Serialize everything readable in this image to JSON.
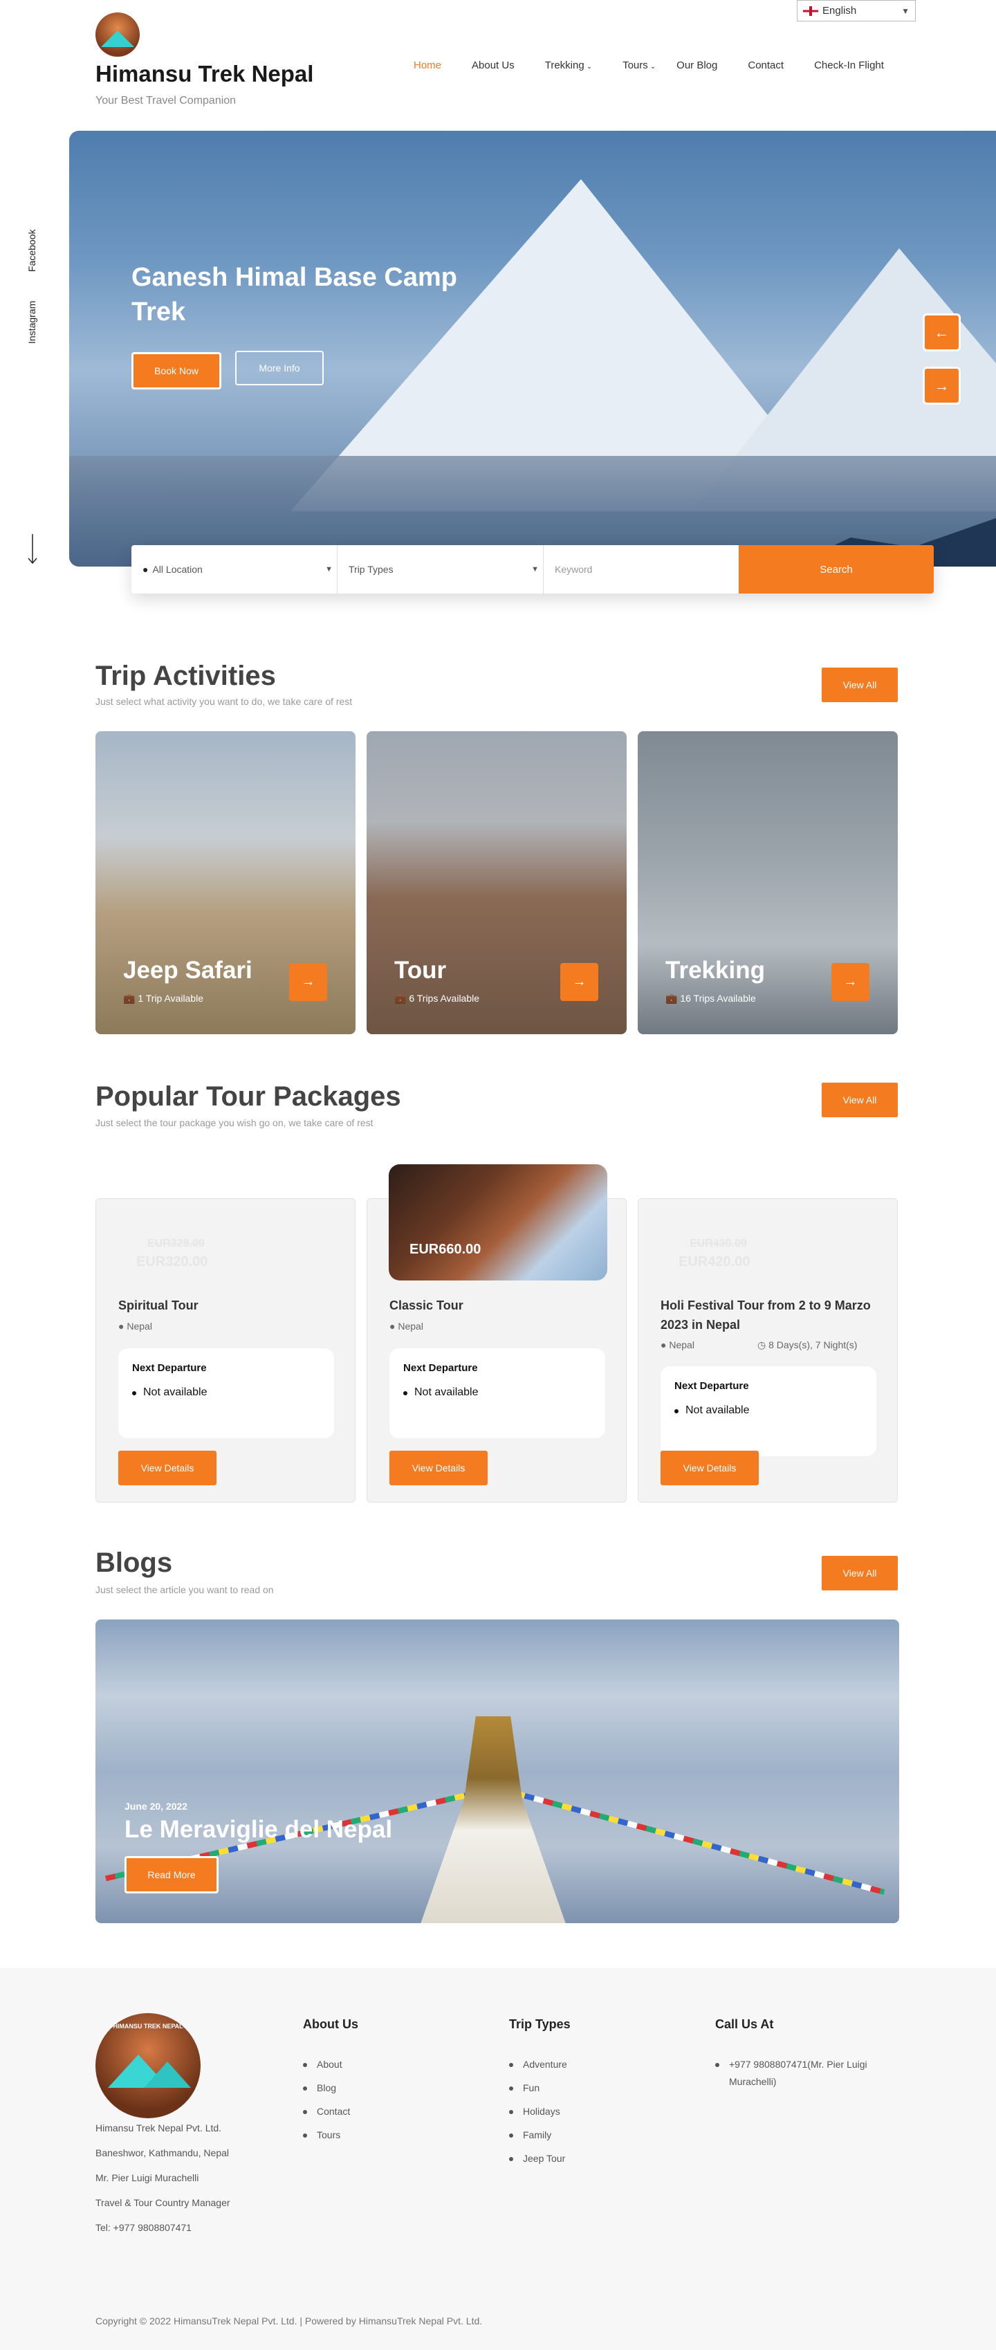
{
  "language": {
    "selected": "English"
  },
  "brand": {
    "title": "Himansu Trek Nepal",
    "tagline": "Your Best Travel Companion"
  },
  "nav": {
    "home": "Home",
    "about": "About Us",
    "trekking": "Trekking",
    "tours": "Tours",
    "blog": "Our Blog",
    "contact": "Contact",
    "checkin": "Check-In Flight"
  },
  "social": {
    "facebook": "Facebook",
    "instagram": "Instagram"
  },
  "hero": {
    "title": "Ganesh Himal Base Camp Trek",
    "book_label": "Book Now",
    "more_label": "More Info"
  },
  "search": {
    "location": "All Location",
    "trip_types": "Trip Types",
    "keyword_placeholder": "Keyword",
    "button": "Search"
  },
  "activities": {
    "title": "Trip Activities",
    "subtitle": "Just select what activity you want to do, we take care of rest",
    "view_all": "View All",
    "items": [
      {
        "name": "Jeep Safari",
        "count": "1 Trip Available"
      },
      {
        "name": "Tour",
        "count": "6 Trips Available"
      },
      {
        "name": "Trekking",
        "count": "16 Trips Available"
      }
    ]
  },
  "packages": {
    "title": "Popular Tour Packages",
    "subtitle": "Just select the tour package you wish go on, we take care of rest",
    "view_all": "View All",
    "next_departure_label": "Next Departure",
    "not_available": "Not available",
    "details_label": "View Details",
    "items": [
      {
        "name": "Spiritual Tour",
        "old_price": "EUR328.00",
        "price": "EUR320.00",
        "location": "Nepal"
      },
      {
        "name": "Classic Tour",
        "price": "EUR660.00",
        "location": "Nepal"
      },
      {
        "name": "Holi Festival Tour from 2 to 9 Marzo 2023 in Nepal",
        "old_price": "EUR430.00",
        "price": "EUR420.00",
        "location": "Nepal",
        "duration": "8 Days(s), 7 Night(s)"
      }
    ]
  },
  "blogs": {
    "title": "Blogs",
    "subtitle": "Just select the article you want to read on",
    "view_all": "View All",
    "post": {
      "date": "June 20, 2022",
      "title": "Le Meraviglie del Nepal",
      "read_more": "Read More"
    }
  },
  "footer": {
    "logo_text": "HIMANSU TREK NEPAL",
    "company": "Himansu Trek Nepal Pvt. Ltd.",
    "address": "Baneshwor, Kathmandu, Nepal",
    "person": "Mr. Pier Luigi Murachelli",
    "role": "Travel & Tour Country Manager",
    "tel": "Tel: +977 9808807471",
    "about_head": "About Us",
    "about_links": [
      "About",
      "Blog",
      "Contact",
      "Tours"
    ],
    "trip_head": "Trip Types",
    "trip_links": [
      "Adventure",
      "Fun",
      "Holidays",
      "Family",
      "Jeep Tour"
    ],
    "call_head": "Call Us At",
    "call_line1": "+977 9808807471(Mr. Pier Luigi",
    "call_line2": "Murachelli)",
    "copyright": "Copyright © 2022 HimansuTrek Nepal Pvt. Ltd. | Powered by HimansuTrek Nepal Pvt. Ltd."
  },
  "colors": {
    "accent": "#f47b20"
  }
}
